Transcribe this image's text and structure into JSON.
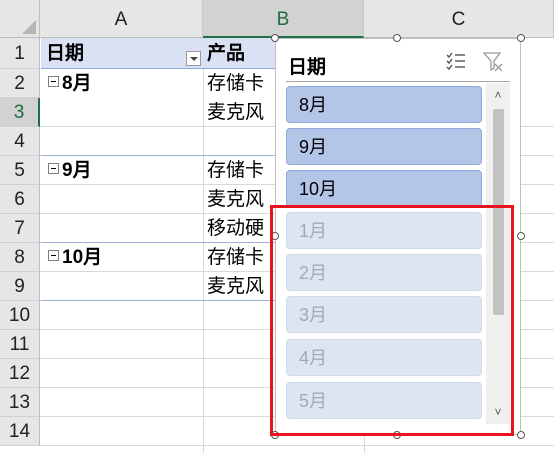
{
  "columns": [
    {
      "label": "A"
    },
    {
      "label": "B"
    },
    {
      "label": "C"
    }
  ],
  "rows": [
    "1",
    "2",
    "3",
    "4",
    "5",
    "6",
    "7",
    "8",
    "9",
    "10",
    "11",
    "12",
    "13",
    "14"
  ],
  "pivot": {
    "header_a": "日期",
    "header_b": "产品",
    "groups": [
      {
        "label": "8月"
      },
      {
        "label": "9月"
      },
      {
        "label": "10月"
      }
    ],
    "products": [
      "存储卡",
      "麦克风",
      "存储卡",
      "麦克风",
      "移动硬",
      "存储卡",
      "麦克风"
    ]
  },
  "slicer": {
    "title": "日期",
    "items": [
      {
        "label": "8月",
        "state": "selected"
      },
      {
        "label": "9月",
        "state": "selected"
      },
      {
        "label": "10月",
        "state": "selected"
      },
      {
        "label": "1月",
        "state": "no-data"
      },
      {
        "label": "2月",
        "state": "no-data"
      },
      {
        "label": "3月",
        "state": "no-data"
      },
      {
        "label": "4月",
        "state": "no-data"
      },
      {
        "label": "5月",
        "state": "no-data"
      }
    ],
    "scroll_up_glyph": "˄",
    "scroll_down_glyph": "˅",
    "multi_select_icon": "multi-select-icon",
    "clear_filter_icon": "clear-filter-icon"
  },
  "colors": {
    "selected_item": "#b4c6e7",
    "unavailable_item": "#dde4f2",
    "header_band": "#d9e1f2",
    "highlight_box": "#e8141d",
    "active_header": "#1e7145"
  }
}
